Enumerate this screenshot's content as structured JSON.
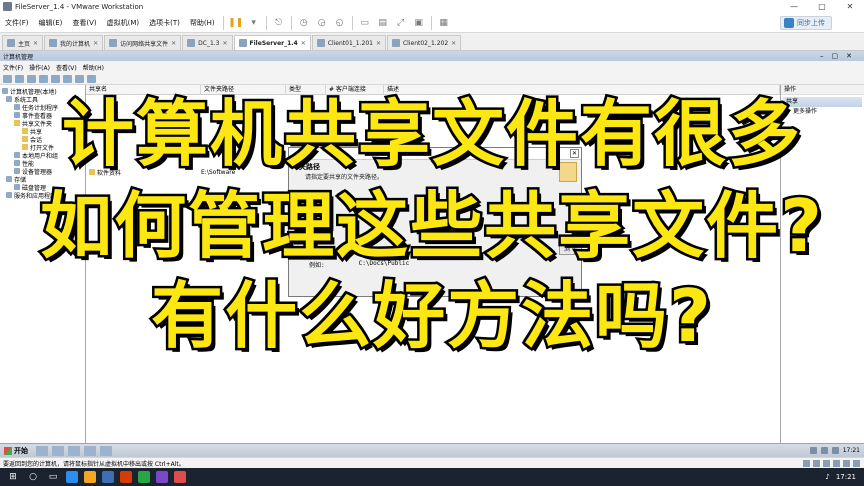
{
  "window": {
    "title": "FileServer_1.4 - VMware Workstation",
    "min": "—",
    "max": "▢",
    "close": "✕"
  },
  "menubar": {
    "items": [
      "文件(F)",
      "编辑(E)",
      "查看(V)",
      "虚拟机(M)",
      "选项卡(T)",
      "帮助(H)"
    ],
    "sync_label": "同步上传"
  },
  "tabs": [
    {
      "label": "主页",
      "active": false
    },
    {
      "label": "我的计算机",
      "active": false
    },
    {
      "label": "访问网络共享文件",
      "active": false
    },
    {
      "label": "DC_1.3",
      "active": false
    },
    {
      "label": "FileServer_1.4",
      "active": true
    },
    {
      "label": "Client01_1.201",
      "active": false
    },
    {
      "label": "Client02_1.202",
      "active": false
    }
  ],
  "mmc": {
    "title": "计算机管理",
    "menu": [
      "文件(F)",
      "操作(A)",
      "查看(V)",
      "帮助(H)"
    ],
    "tree": [
      {
        "label": "计算机管理(本地)",
        "indent": 0
      },
      {
        "label": "系统工具",
        "indent": 1
      },
      {
        "label": "任务计划程序",
        "indent": 2
      },
      {
        "label": "事件查看器",
        "indent": 2
      },
      {
        "label": "共享文件夹",
        "indent": 2
      },
      {
        "label": "共享",
        "indent": 3
      },
      {
        "label": "会话",
        "indent": 3
      },
      {
        "label": "打开文件",
        "indent": 3
      },
      {
        "label": "本地用户和组",
        "indent": 2
      },
      {
        "label": "性能",
        "indent": 2
      },
      {
        "label": "设备管理器",
        "indent": 2
      },
      {
        "label": "存储",
        "indent": 1
      },
      {
        "label": "磁盘管理",
        "indent": 2
      },
      {
        "label": "服务和应用程序",
        "indent": 1
      }
    ],
    "columns": [
      "共享名",
      "文件夹路径",
      "类型",
      "# 客户端连接",
      "描述"
    ],
    "rows": [
      {
        "name": "软件资料",
        "path": "E:\\Software"
      }
    ],
    "actions": {
      "header": "操作",
      "sub": "共享",
      "more": "更多操作"
    }
  },
  "dialog": {
    "label": "夹路径",
    "desc": "请指定要共享的文件夹路径。",
    "example_label": "例如:",
    "example_value": "C:\\Docs\\Public",
    "browse": "浏"
  },
  "guest_taskbar": {
    "start": "开始",
    "tray_time": "17:21"
  },
  "statusbar": {
    "text": "要返回到您的计算机，请将鼠标指针从虚拟机中移出或按 Ctrl+Alt。"
  },
  "host_taskbar": {
    "time": "17:21"
  },
  "overlay": {
    "line1": "计算机共享文件有很多",
    "line2": "如何管理这些共享文件?",
    "line3": "有什么好方法吗?"
  }
}
